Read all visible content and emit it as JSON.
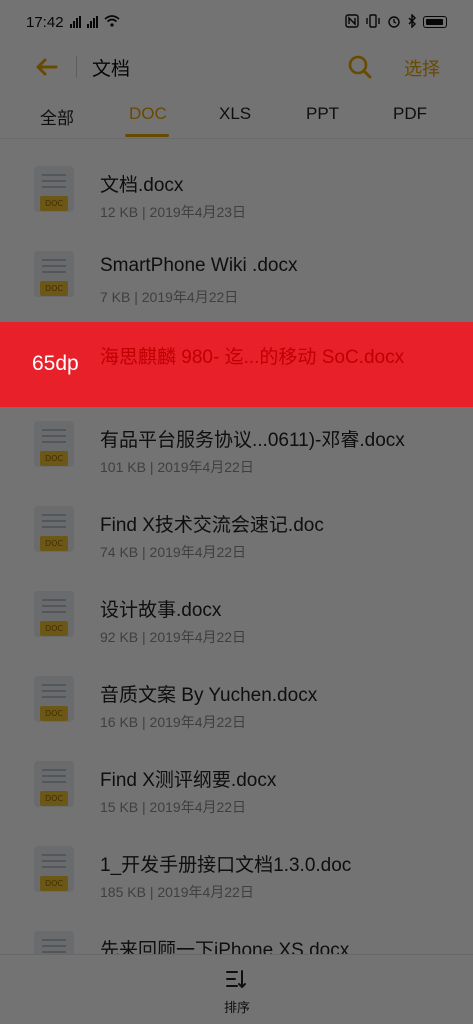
{
  "status_bar": {
    "time": "17:42"
  },
  "header": {
    "title": "文档",
    "select_label": "选择"
  },
  "tabs": [
    {
      "label": "全部"
    },
    {
      "label": "DOC"
    },
    {
      "label": "XLS"
    },
    {
      "label": "PPT"
    },
    {
      "label": "PDF"
    }
  ],
  "active_tab": "DOC",
  "file_icon_badge": "DOC",
  "files": [
    {
      "name": "文档.docx",
      "meta": "12 KB | 2019年4月23日"
    },
    {
      "name": "SmartPhone Wiki .docx",
      "meta": "7 KB | 2019年4月22日"
    },
    {
      "name": "海思麒麟 980- 迄...的移动 SoC.docx",
      "meta": ""
    },
    {
      "name": "有品平台服务协议...0611)-邓睿.docx",
      "meta": "101 KB | 2019年4月22日"
    },
    {
      "name": "Find X技术交流会速记.doc",
      "meta": "74 KB | 2019年4月22日"
    },
    {
      "name": "设计故事.docx",
      "meta": "92 KB | 2019年4月22日"
    },
    {
      "name": "音质文案 By Yuchen.docx",
      "meta": "16 KB | 2019年4月22日"
    },
    {
      "name": "Find X测评纲要.docx",
      "meta": "15 KB | 2019年4月22日"
    },
    {
      "name": "1_开发手册接口文档1.3.0.doc",
      "meta": "185 KB | 2019年4月22日"
    },
    {
      "name": "先来回顾一下iPhone XS.docx",
      "meta": ""
    }
  ],
  "measurement": {
    "label": "65dp"
  },
  "bottom_bar": {
    "sort_label": "排序"
  },
  "colors": {
    "accent": "#e6a500",
    "highlight": "#e8202a",
    "badge": "#f1c232"
  }
}
